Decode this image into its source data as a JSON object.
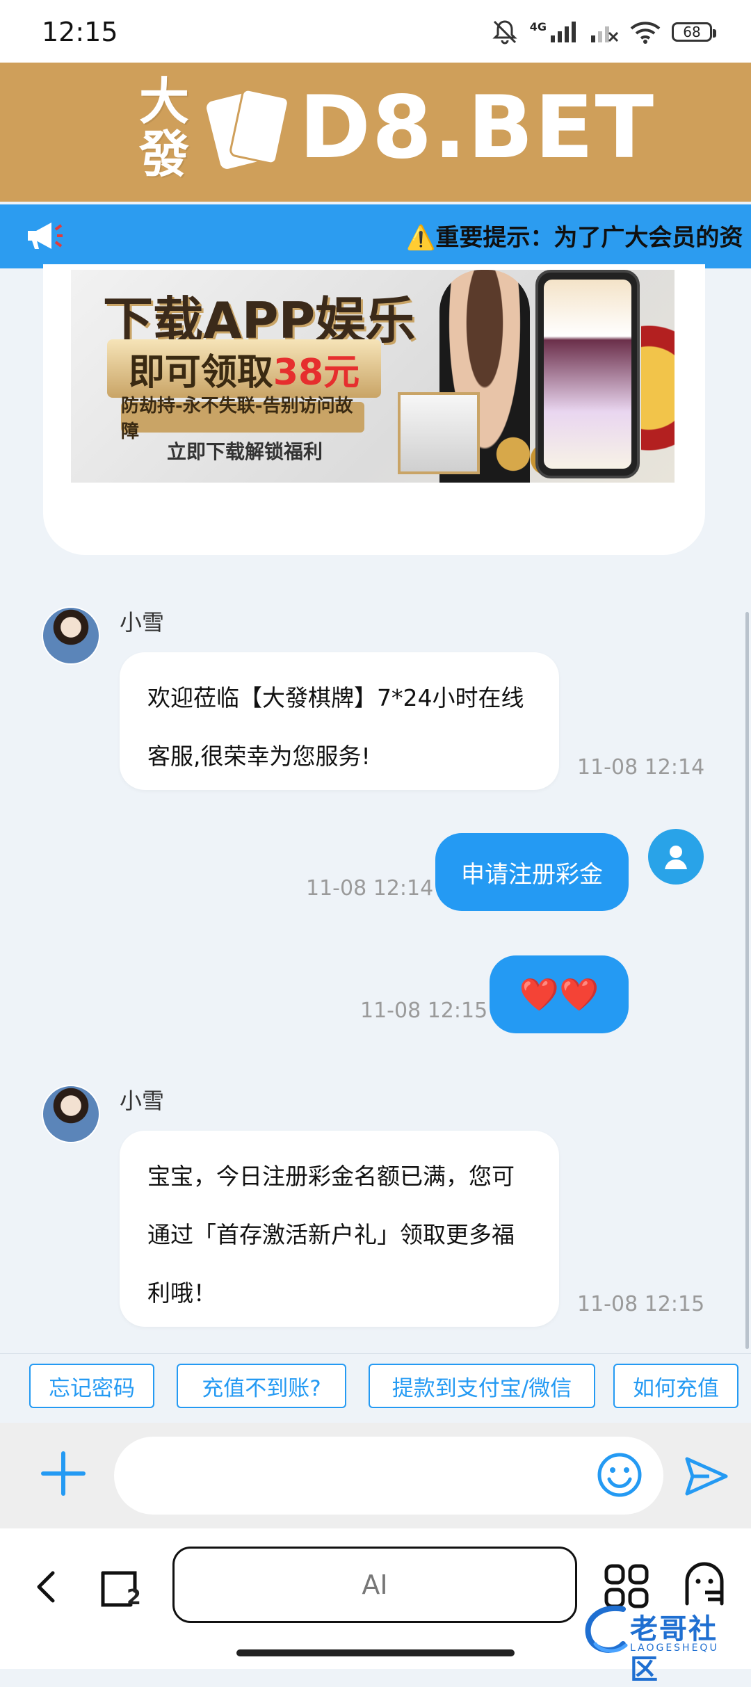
{
  "status_bar": {
    "time": "12:15",
    "network": "4G",
    "battery": "68"
  },
  "brand": {
    "chars": "大發",
    "name": "D8.BET",
    "background_color": "#cf9f5a"
  },
  "notice": {
    "text": "⚠️重要提示：为了广大会员的资"
  },
  "banner": {
    "title": "下载APP娱乐",
    "plaque_prefix": "即可领取",
    "plaque_amount": "38元",
    "subtitle": "防劫持-永不失联-告别访问故障",
    "cta": "立即下载解锁福利"
  },
  "messages": [
    {
      "side": "in",
      "sender": "小雪",
      "lines": [
        "欢迎莅临【大發棋牌】7*24小时在线",
        "客服,很荣幸为您服务!"
      ],
      "time": "11-08 12:14"
    },
    {
      "side": "out",
      "text": "申请注册彩金",
      "time": "11-08 12:14"
    },
    {
      "side": "out",
      "text": "❤️❤️",
      "time": "11-08 12:15"
    },
    {
      "side": "in",
      "sender": "小雪",
      "lines": [
        "宝宝，今日注册彩金名额已满，您可",
        "通过「首存激活新户礼」领取更多福",
        "利哦！"
      ],
      "time": "11-08 12:15"
    }
  ],
  "quick_replies": [
    "忘记密码",
    "充值不到账?",
    "提款到支付宝/微信",
    "如何充值"
  ],
  "input": {
    "placeholder": ""
  },
  "browser": {
    "tab_count": "2",
    "address_label": "AI"
  },
  "watermark": {
    "text": "老哥社区",
    "sub": "LAOGESHEQU"
  },
  "colors": {
    "accent": "#249af3",
    "notice": "#2c9cf0",
    "chat_background": "#eef3f8"
  }
}
